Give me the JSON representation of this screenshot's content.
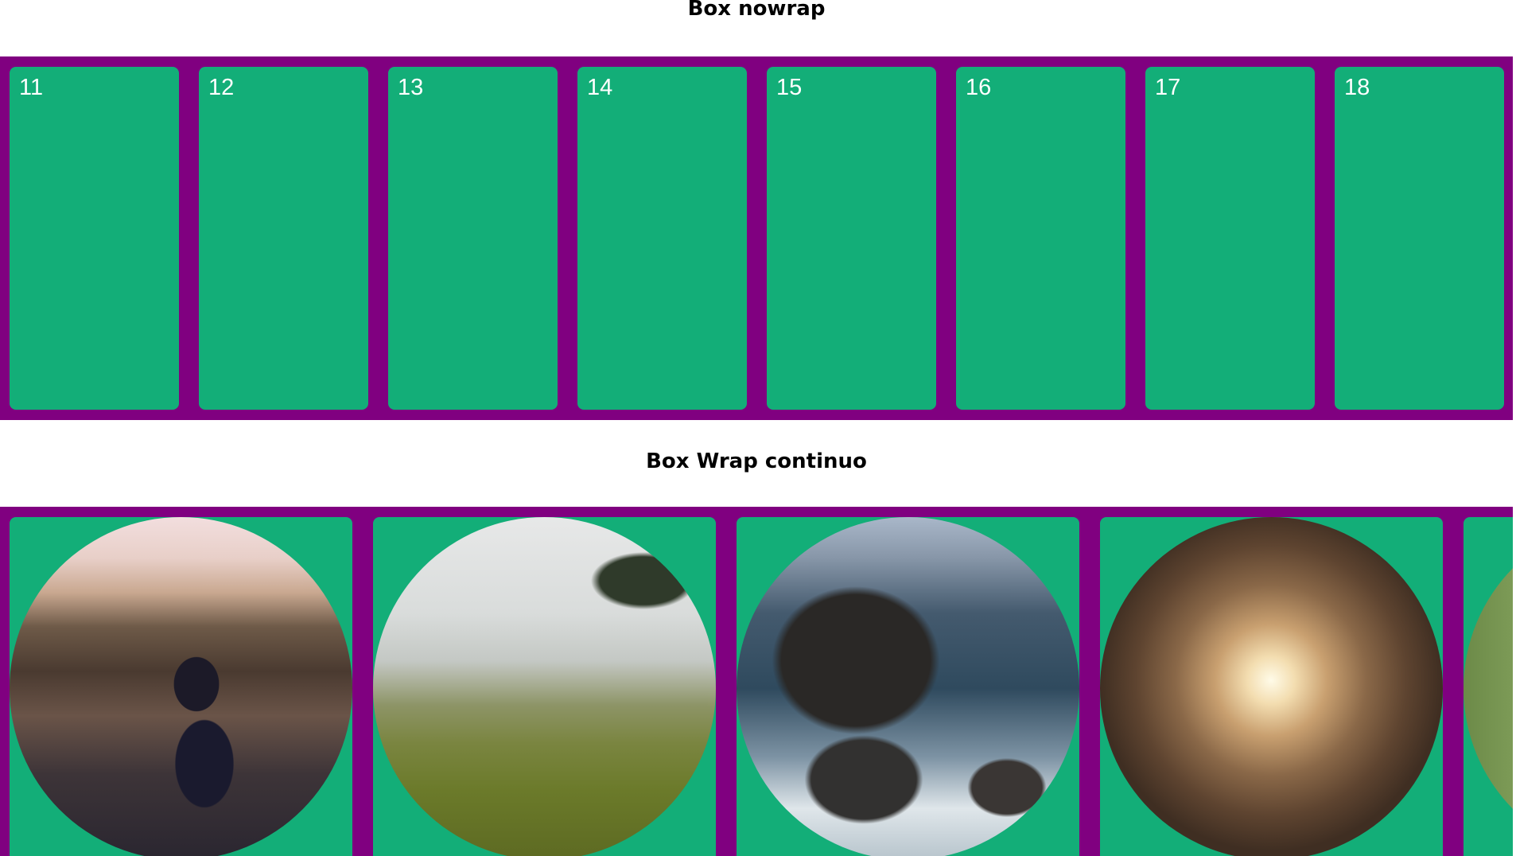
{
  "sections": {
    "nowrap": {
      "title": "Box nowrap",
      "boxes": [
        "11",
        "12",
        "13",
        "14",
        "15",
        "16",
        "17",
        "18"
      ]
    },
    "wrap": {
      "title": "Box Wrap continuo",
      "images": [
        {
          "subject": "person-overlooking-city"
        },
        {
          "subject": "foggy-hillside"
        },
        {
          "subject": "sea-cliffs"
        },
        {
          "subject": "tunnel-light"
        },
        {
          "subject": "forest"
        }
      ]
    }
  },
  "colors": {
    "container": "#800080",
    "box": "#13ae78",
    "box_text": "#ffffff",
    "title_text": "#000000"
  }
}
